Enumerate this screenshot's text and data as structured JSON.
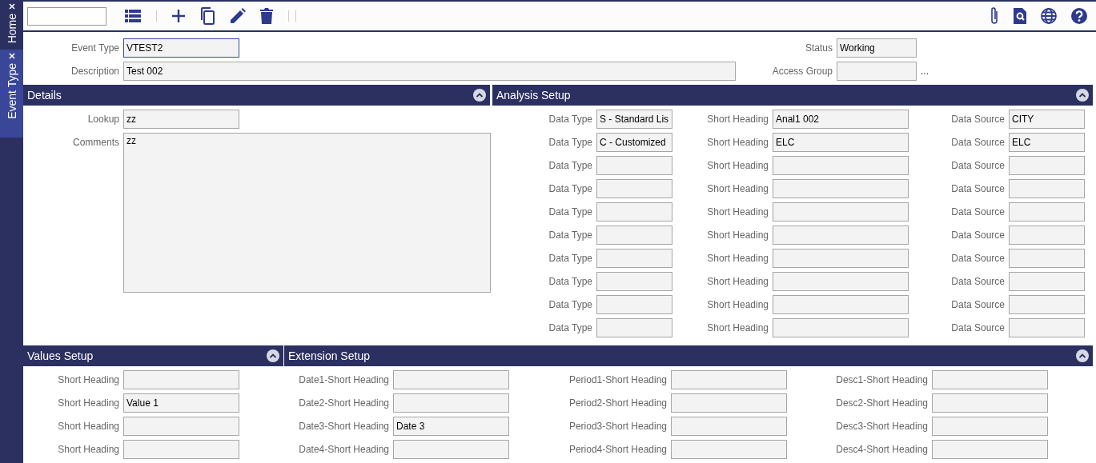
{
  "sidebar": {
    "tabs": [
      {
        "label": "Home",
        "selected": false
      },
      {
        "label": "Event Type",
        "selected": true
      }
    ]
  },
  "header": {
    "fields": [
      {
        "label": "Event Type",
        "value": "VTEST2",
        "focused": true
      },
      {
        "label": "Status",
        "value": "Working",
        "focused": false
      },
      {
        "label": "Description",
        "value": "Test 002",
        "focused": false
      },
      {
        "label": "Access Group",
        "focused": false
      }
    ],
    "lookup_button": "..."
  },
  "details": {
    "title": "Details",
    "expanded": true,
    "lookup": {
      "label": "Lookup",
      "value": "zz"
    },
    "comments": {
      "label": "Comments",
      "value": "zz"
    }
  },
  "analysis_setup": {
    "title": "Analysis Setup",
    "expanded": true,
    "rows": [
      [
        {
          "label": "Data Type",
          "value": "S - Standard Lis"
        },
        {
          "label": "Short Heading",
          "value": "Anal1 002"
        },
        {
          "label": "Data Source",
          "value": "CITY"
        }
      ],
      [
        {
          "label": "Data Type",
          "value": "C - Customized"
        },
        {
          "label": "Short Heading",
          "value": "ELC"
        },
        {
          "label": "Data Source",
          "value": "ELC"
        }
      ],
      [
        {
          "label": "Data Type"
        },
        {
          "label": "Short Heading"
        },
        {
          "label": "Data Source"
        }
      ],
      [
        {
          "label": "Data Type"
        },
        {
          "label": "Short Heading"
        },
        {
          "label": "Data Source"
        }
      ],
      [
        {
          "label": "Data Type"
        },
        {
          "label": "Short Heading"
        },
        {
          "label": "Data Source"
        }
      ],
      [
        {
          "label": "Data Type"
        },
        {
          "label": "Short Heading"
        },
        {
          "label": "Data Source"
        }
      ],
      [
        {
          "label": "Data Type"
        },
        {
          "label": "Short Heading"
        },
        {
          "label": "Data Source"
        }
      ],
      [
        {
          "label": "Data Type"
        },
        {
          "label": "Short Heading"
        },
        {
          "label": "Data Source"
        }
      ],
      [
        {
          "label": "Data Type"
        },
        {
          "label": "Short Heading"
        },
        {
          "label": "Data Source"
        }
      ],
      [
        {
          "label": "Data Type"
        },
        {
          "label": "Short Heading"
        },
        {
          "label": "Data Source"
        }
      ]
    ]
  },
  "values_setup": {
    "title": "Values Setup",
    "expanded": true,
    "rows": [
      [
        {
          "label": "Short Heading"
        }
      ],
      [
        {
          "label": "Short Heading",
          "value": "Value 1"
        }
      ],
      [
        {
          "label": "Short Heading"
        }
      ],
      [
        {
          "label": "Short Heading"
        }
      ]
    ]
  },
  "extension_setup": {
    "title": "Extension Setup",
    "expanded": true,
    "rows": [
      [
        {
          "label": "Date1-Short Heading"
        },
        {
          "label": "Period1-Short Heading"
        },
        {
          "label": "Desc1-Short Heading"
        }
      ],
      [
        {
          "label": "Date2-Short Heading"
        },
        {
          "label": "Period2-Short Heading"
        },
        {
          "label": "Desc2-Short Heading"
        }
      ],
      [
        {
          "label": "Date3-Short Heading",
          "value": "Date 3"
        },
        {
          "label": "Period3-Short Heading"
        },
        {
          "label": "Desc3-Short Heading"
        }
      ],
      [
        {
          "label": "Date4-Short Heading"
        },
        {
          "label": "Period4-Short Heading"
        },
        {
          "label": "Desc4-Short Heading"
        }
      ]
    ]
  }
}
